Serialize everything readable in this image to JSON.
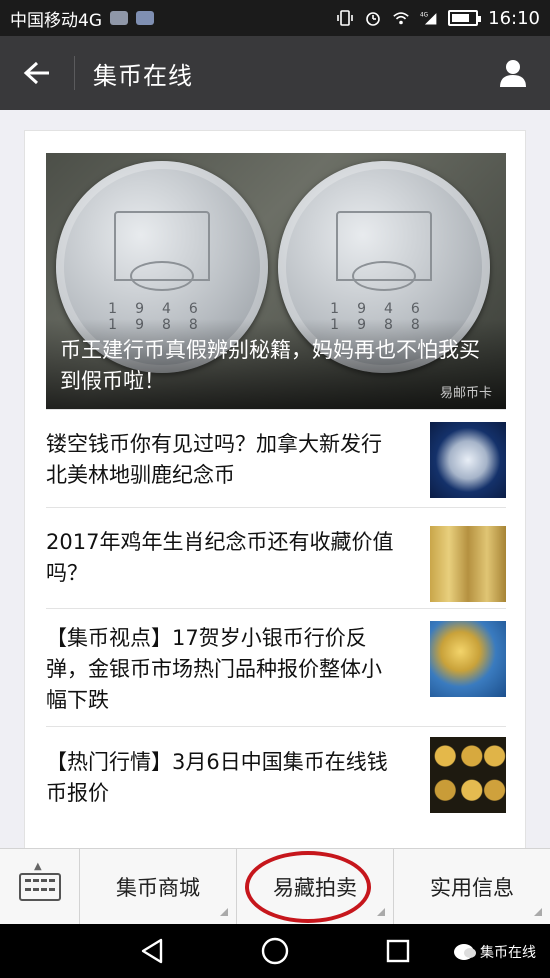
{
  "status_bar": {
    "carrier": "中国移动4G",
    "network": "4G",
    "time": "16:10"
  },
  "header": {
    "title": "集币在线"
  },
  "hero": {
    "title": "币王建行币真假辨别秘籍，妈妈再也不怕我买到假币啦！",
    "years_left": "1946 1988",
    "years_right": "1946 1988",
    "watermark": "易邮币卡"
  },
  "articles": [
    {
      "title": "镂空钱币你有见过吗？加拿大新发行北美林地驯鹿纪念币"
    },
    {
      "title": "2017年鸡年生肖纪念币还有收藏价值吗？"
    },
    {
      "title": "【集币视点】17贺岁小银币行价反弹，金银币市场热门品种报价整体小幅下跌"
    },
    {
      "title": "【热门行情】3月6日中国集币在线钱币报价"
    }
  ],
  "menu": {
    "items": [
      {
        "label": "集币商城"
      },
      {
        "label": "易藏拍卖"
      },
      {
        "label": "实用信息"
      }
    ]
  },
  "nav": {
    "brand": "集币在线"
  },
  "colors": {
    "title_bar": "#39393b",
    "status_bar": "#1b1b1b",
    "highlight_ring": "#c6161c"
  }
}
